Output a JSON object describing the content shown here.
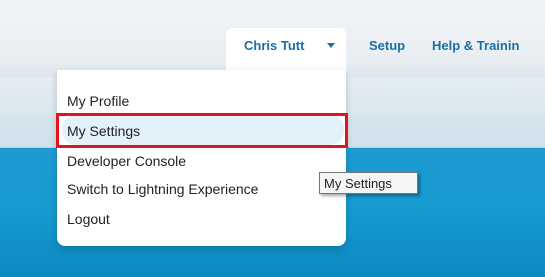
{
  "header": {
    "user_name": "Chris Tutt",
    "setup_label": "Setup",
    "help_label": "Help & Trainin"
  },
  "user_menu": {
    "items": [
      {
        "label": "My Profile"
      },
      {
        "label": "My Settings",
        "highlighted": true
      },
      {
        "label": "Developer Console"
      },
      {
        "label": "Switch to Lightning Experience"
      },
      {
        "label": "Logout"
      }
    ]
  },
  "tooltip": {
    "text": "My Settings"
  },
  "colors": {
    "link": "#1a6fa6",
    "header_blue": "#169bcf",
    "highlight_box": "#e0151e",
    "item_hover": "#e3f1fb"
  },
  "icons": {
    "user_menu_caret": "chevron-down-icon"
  }
}
